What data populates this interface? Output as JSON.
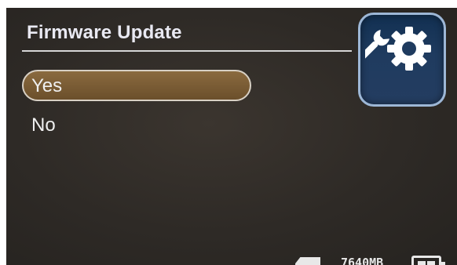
{
  "screen": {
    "title": "Firmware Update",
    "menu": {
      "items": [
        {
          "label": "Yes",
          "selected": true
        },
        {
          "label": "No",
          "selected": false
        }
      ]
    },
    "icons": {
      "settings": "gear-wrench-icon",
      "sd_card": "sd-card-icon",
      "battery": "battery-icon"
    },
    "status": {
      "storage": "7640MB"
    },
    "colors": {
      "background": "#2e2a26",
      "selected_item": "#7a5d35",
      "badge": "#1f3b5f"
    }
  }
}
